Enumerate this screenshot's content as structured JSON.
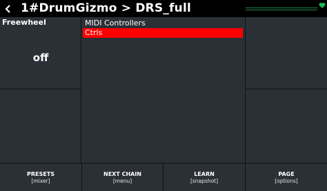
{
  "header": {
    "title": "1#DrumGizmo > DRS_full"
  },
  "controller": {
    "name": "Freewheel",
    "value": "off"
  },
  "list": {
    "items": [
      {
        "label": "MIDI Controllers",
        "selected": false
      },
      {
        "label": "Ctrls",
        "selected": true
      }
    ]
  },
  "buttons": [
    {
      "label": "PRESETS",
      "sub": "[mixer]"
    },
    {
      "label": "NEXT CHAIN",
      "sub": "[menu]"
    },
    {
      "label": "LEARN",
      "sub": "[snapshot]"
    },
    {
      "label": "PAGE",
      "sub": "[options]"
    }
  ],
  "colors": {
    "background": "#2b3036",
    "titlebar": "#000000",
    "selected_item": "#ff0000",
    "status_icon": "#1db954"
  },
  "icons": {
    "back": "chevron-left-icon",
    "status": "heart-icon"
  }
}
